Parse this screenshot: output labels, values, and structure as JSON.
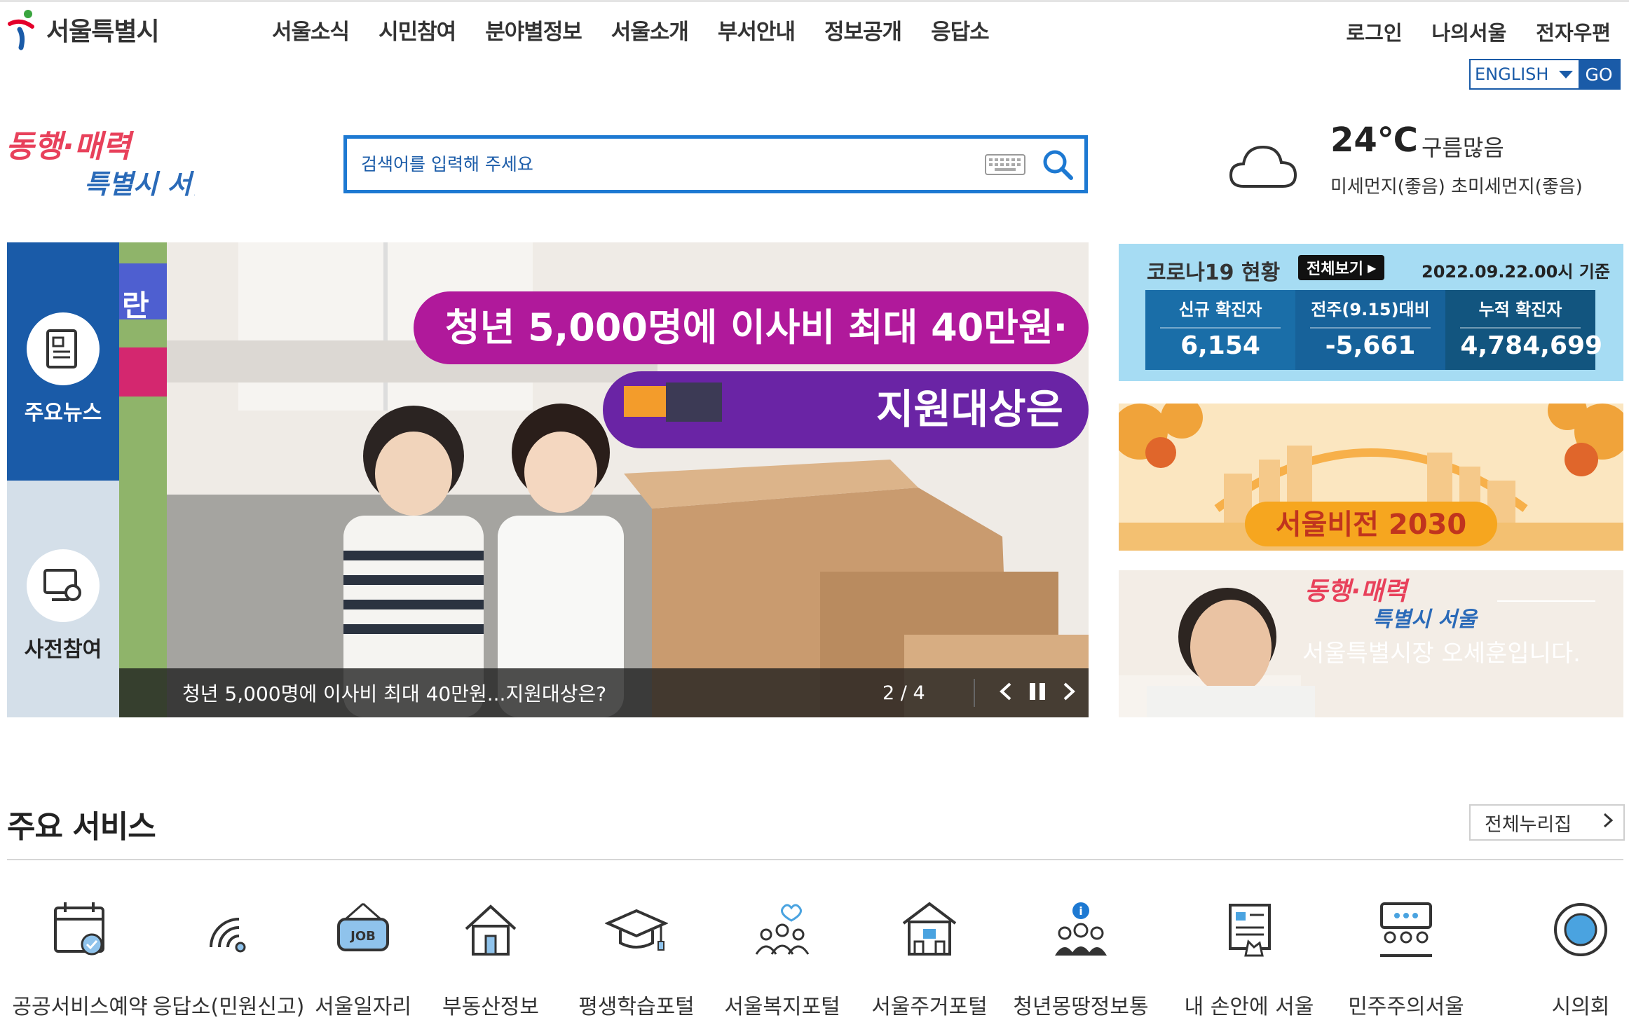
{
  "header": {
    "logo_text": "서울특별시",
    "gnb": [
      "서울소식",
      "시민참여",
      "분야별정보",
      "서울소개",
      "부서안내",
      "정보공개",
      "응답소"
    ],
    "util": [
      "로그인",
      "나의서울",
      "전자우편"
    ],
    "language": {
      "selected": "ENGLISH",
      "go_label": "GO"
    }
  },
  "slogan": {
    "line1": "동행·매력",
    "line2": "특별시 서울"
  },
  "search": {
    "placeholder": "검색어를 입력해 주세요"
  },
  "weather": {
    "temperature": "24℃",
    "condition": "구름많음",
    "dust": "미세먼지(좋음) 초미세먼지(좋음)",
    "icon": "cloud-icon"
  },
  "tabs": [
    {
      "label": "주요뉴스",
      "icon": "news-icon",
      "active": true
    },
    {
      "label": "사전참여",
      "icon": "monitor-icon",
      "active": false
    }
  ],
  "banner": {
    "headline1": "청년 5,000명에 이사비 최대 40만원·",
    "headline2": "지원대상은",
    "caption": "청년 5,000명에 이사비 최대 40만원...지원대상은?",
    "counter": "2 / 4",
    "side_glyph": "란"
  },
  "covid": {
    "title": "코로나19 현황",
    "view_all": "전체보기",
    "date": "2022.09.22.00시 기준",
    "stats": [
      {
        "label": "신규 확진자",
        "value": "6,154"
      },
      {
        "label": "전주(9.15)대비",
        "value": "-5,661"
      },
      {
        "label": "누적 확진자",
        "value": "4,784,699"
      }
    ]
  },
  "vision": {
    "label": "서울비전 2030"
  },
  "mayor": {
    "slogan1": "동행·매력",
    "slogan2": "특별시 서울",
    "text": "서울특별시장 오세훈입니다."
  },
  "services": {
    "title": "주요 서비스",
    "all_label": "전체누리집",
    "items": [
      {
        "label": "공공서비스예약",
        "icon": "calendar-check-icon"
      },
      {
        "label": "응답소(민원신고)",
        "icon": "signal-icon"
      },
      {
        "label": "서울일자리",
        "icon": "job-sign-icon"
      },
      {
        "label": "부동산정보",
        "icon": "house-icon"
      },
      {
        "label": "평생학습포털",
        "icon": "graduation-cap-icon"
      },
      {
        "label": "서울복지포털",
        "icon": "community-heart-icon"
      },
      {
        "label": "서울주거포털",
        "icon": "building-icon"
      },
      {
        "label": "청년몽땅정보통",
        "icon": "youth-info-icon"
      },
      {
        "label": "내 손안에 서울",
        "icon": "mobile-news-icon"
      },
      {
        "label": "민주주의서울",
        "icon": "meeting-icon"
      },
      {
        "label": "시의회",
        "icon": "council-seal-icon"
      }
    ]
  },
  "colors": {
    "primary": "#1a5ba8",
    "search_border": "#1d79d2",
    "covid_bg": "#a6dcf3",
    "covid_box": "#1a6ea8",
    "tab_inactive": "#d4dfe9",
    "banner_magenta": "#b0199b",
    "banner_purple": "#6a24a5"
  }
}
